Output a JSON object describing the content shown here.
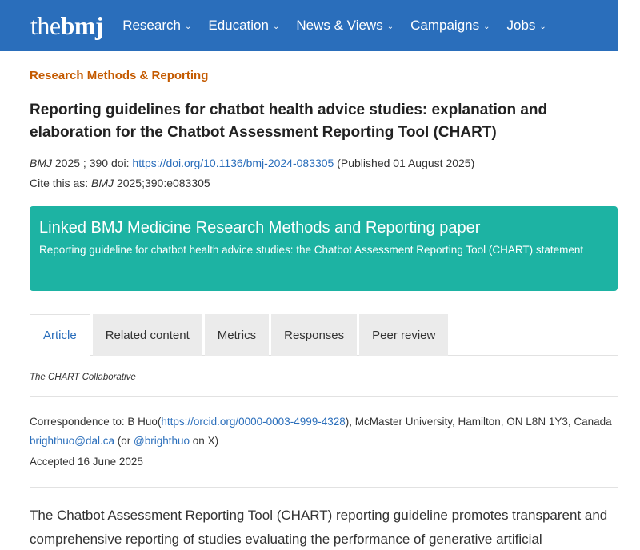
{
  "header": {
    "logo_thin": "the",
    "logo_bold": "bmj",
    "nav": [
      {
        "label": "Research"
      },
      {
        "label": "Education"
      },
      {
        "label": "News & Views"
      },
      {
        "label": "Campaigns"
      },
      {
        "label": "Jobs"
      }
    ],
    "chevron_icon": "chevron-down-icon"
  },
  "article": {
    "section": "Research Methods & Reporting",
    "title": "Reporting guidelines for chatbot health advice studies: explanation and elaboration for the Chatbot Assessment Reporting Tool (CHART)",
    "journal": "BMJ",
    "volume_text": " 2025 ; 390  doi: ",
    "doi_link": "https://doi.org/10.1136/bmj-2024-083305",
    "published": " (Published 01 August 2025)",
    "cite_prefix": "Cite this as: ",
    "cite_journal": "BMJ",
    "cite_ref": " 2025;390:e083305"
  },
  "linked": {
    "heading": "Linked BMJ Medicine Research Methods and Reporting paper",
    "sub": "Reporting guideline for chatbot health advice studies: the Chatbot Assessment Reporting Tool (CHART) statement"
  },
  "tabs": [
    {
      "label": "Article",
      "active": true
    },
    {
      "label": "Related content"
    },
    {
      "label": "Metrics"
    },
    {
      "label": "Responses"
    },
    {
      "label": "Peer review"
    }
  ],
  "authors": "The CHART Collaborative",
  "correspondence": {
    "prefix": "Correspondence to: B Huo(",
    "orcid": "https://orcid.org/0000-0003-4999-4328",
    "mid": "), McMaster University, Hamilton, ON L8N 1Y3, Canada ",
    "email": "brighthuo@dal.ca",
    "or_text": " (or ",
    "handle": "@brighthuo",
    "suffix": " on X)"
  },
  "accepted": "Accepted 16 June 2025",
  "abstract": "The Chatbot Assessment Reporting Tool (CHART) reporting guideline promotes transparent and comprehensive reporting of studies evaluating the performance of generative artificial"
}
